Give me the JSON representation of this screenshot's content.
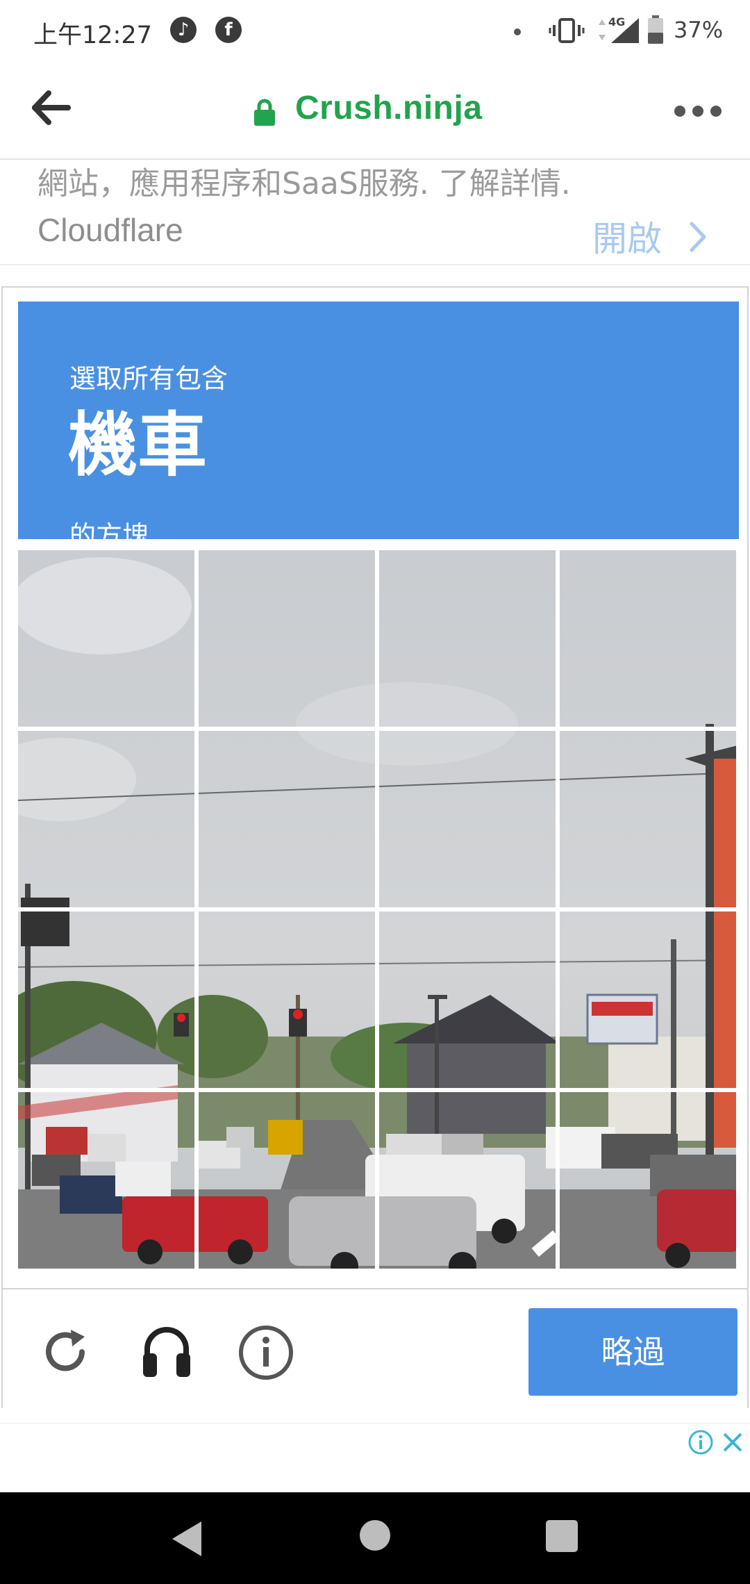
{
  "status_bar": {
    "time": "上午12:27",
    "music_icon": "music-note-icon",
    "facebook_icon": "facebook-icon",
    "network_label": "4G",
    "battery_percent": "37%"
  },
  "browser": {
    "domain": "Crush.ninja",
    "domain_color": "#22a34d",
    "back_icon": "arrow-left-icon",
    "lock_icon": "lock-icon",
    "menu_icon": "more-horizontal-icon"
  },
  "promo": {
    "description": "網站，應用程序和SaaS服務. 了解詳情.",
    "brand": "Cloudflare",
    "open_label": "開啟"
  },
  "captcha": {
    "accent_color": "#4a90e2",
    "instruction_prefix": "選取所有包含",
    "target_object": "機車",
    "instruction_suffix": "的方塊",
    "grid_rows": 4,
    "grid_cols": 4,
    "skip_label": "略過",
    "icons": [
      "reload-icon",
      "headphones-icon",
      "info-icon"
    ]
  },
  "ad": {
    "info_icon": "ad-info-icon",
    "close_icon": "close-icon"
  }
}
